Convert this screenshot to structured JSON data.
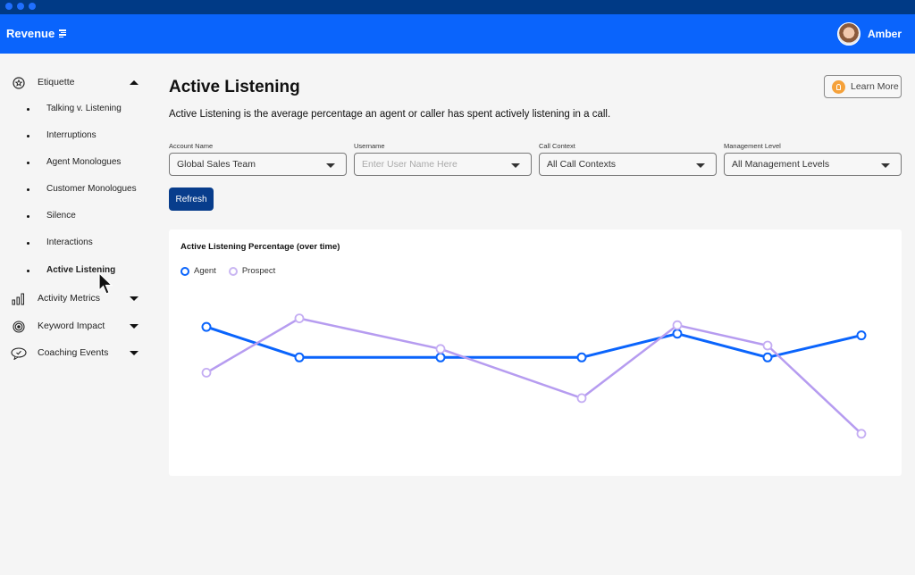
{
  "window": {
    "controls": [
      "close",
      "minimize",
      "maximize"
    ]
  },
  "header": {
    "brand": "Revenue",
    "brand_icon": "menu-lines-icon",
    "user_name": "Amber"
  },
  "sidebar": {
    "sections": [
      {
        "label": "Etiquette",
        "icon": "star-circle-icon",
        "expanded": true,
        "items": [
          {
            "label": "Talking v. Listening"
          },
          {
            "label": "Interruptions"
          },
          {
            "label": "Agent Monologues"
          },
          {
            "label": "Customer Monologues"
          },
          {
            "label": "Silence"
          },
          {
            "label": "Interactions"
          },
          {
            "label": "Active Listening",
            "active": true
          }
        ]
      },
      {
        "label": "Activity Metrics",
        "icon": "bar-chart-icon",
        "expanded": false
      },
      {
        "label": "Keyword Impact",
        "icon": "target-icon",
        "expanded": false
      },
      {
        "label": "Coaching Events",
        "icon": "chat-check-icon",
        "expanded": false
      }
    ]
  },
  "main": {
    "title": "Active Listening",
    "description": "Active Listening is the average percentage an agent or caller has spent actively listening in a call.",
    "learn_more": "Learn More",
    "filters": [
      {
        "label": "Account Name",
        "value": "Global Sales Team",
        "placeholder": ""
      },
      {
        "label": "Username",
        "value": "",
        "placeholder": "Enter User Name Here"
      },
      {
        "label": "Call Context",
        "value": "All Call Contexts",
        "placeholder": ""
      },
      {
        "label": "Management Level",
        "value": "All Management Levels",
        "placeholder": ""
      }
    ],
    "refresh": "Refresh"
  },
  "colors": {
    "brand": "#0a64fc",
    "agent": "#0a64fc",
    "prospect": "#b69cf0",
    "button": "#083d8c"
  },
  "chart_data": {
    "type": "line",
    "title": "Active Listening Percentage (over time)",
    "xlabel": "",
    "ylabel": "",
    "x": [
      1,
      2,
      3,
      4,
      5,
      6,
      7
    ],
    "ylim": [
      0,
      100
    ],
    "grid": false,
    "legend": "top-left",
    "series": [
      {
        "name": "Agent",
        "values": [
          81,
          63,
          63,
          63,
          77,
          63,
          76
        ]
      },
      {
        "name": "Prospect",
        "values": [
          54,
          86,
          68,
          39,
          82,
          70,
          18
        ]
      }
    ]
  }
}
